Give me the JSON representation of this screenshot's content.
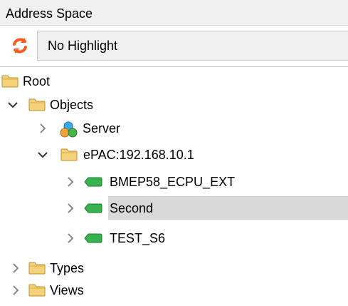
{
  "panel": {
    "title": "Address Space"
  },
  "toolbar": {
    "refresh_icon": "refresh-icon",
    "highlight_value": "No Highlight"
  },
  "tree": {
    "root": "Root",
    "objects": "Objects",
    "server": "Server",
    "epac": "ePAC:192.168.10.1",
    "bmep": "BMEP58_ECPU_EXT",
    "second": "Second",
    "test": "TEST_S6",
    "types": "Types",
    "views": "Views",
    "selected": "Second"
  },
  "colors": {
    "folder": "#e8c14f",
    "tag": "#2ea84a",
    "selection": "#d9d9d9",
    "refresh": "#ff5a1f"
  }
}
